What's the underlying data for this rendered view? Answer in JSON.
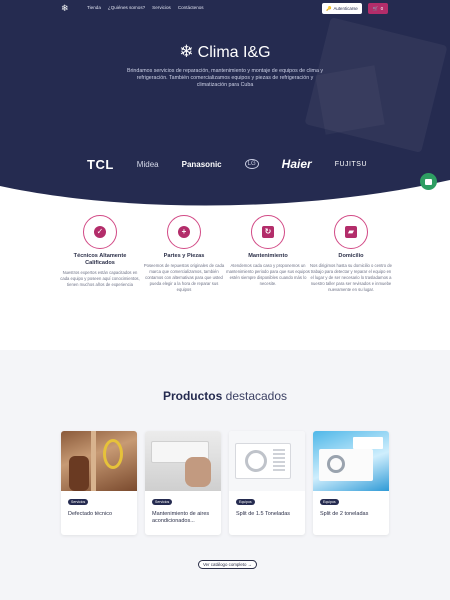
{
  "nav": {
    "logo_icon": "snowflake-icon",
    "links": [
      "Tienda",
      "¿Quiénes somos?",
      "Servicios",
      "Contáctenos"
    ],
    "auth_label": "Autenticarse",
    "cart_count": "0"
  },
  "hero": {
    "title": "Clima I&G",
    "description": "Brindamos servicios de reparación, mantenimiento y montaje de equipos de clima y refrigeración. También comercializamos equipos y piezas de refrigeración y climatización para Cuba"
  },
  "brands": [
    "TCL",
    "Midea",
    "Panasonic",
    "LG",
    "Haier",
    "FUJITSU"
  ],
  "services": [
    {
      "title": "Técnicos Altamente Calificados",
      "description": "Nuestros expertos están capacitados en cada equipo y poseen aquí conocimientos, tienen muchos años de experiencia",
      "icon": "user-check-icon"
    },
    {
      "title": "Partes y Piezas",
      "description": "Poseemos de repuestos originales de cada marca que comercializamos, también contamos con alternativas para que usted pueda elegir a la hora de reparar sus equipos",
      "icon": "plus-icon"
    },
    {
      "title": "Mantenimiento",
      "description": "Atendemos cada caso y proponemos un mantenimiento periodo para que sus equipos estén siempre disponibles cuando más lo necesite.",
      "icon": "refresh-icon"
    },
    {
      "title": "Domicilio",
      "description": "Nos dirigimos hasta su domicilio o centro de trabajo para detectar y reparar el equipo en el lugar y de ser necesario lo trasladamos a nuestro taller para ser revisados e inmuebe nuevamente en su lugar.",
      "icon": "truck-icon"
    }
  ],
  "products": {
    "title_bold": "Productos",
    "title_light": "destacados",
    "items": [
      {
        "tag": "Servicios",
        "name": "Defectado técnico"
      },
      {
        "tag": "Servicios",
        "name": "Mantenimiento de aires acondicionados..."
      },
      {
        "tag": "Equipos",
        "name": "Split de 1.5 Toneladas"
      },
      {
        "tag": "Equipos",
        "name": "Split de 2 toneladas"
      }
    ],
    "catalog_label": "Ver catálogo completo →"
  },
  "colors": {
    "primary": "#252b50",
    "accent": "#b32d6a",
    "chat": "#2e9e62"
  }
}
